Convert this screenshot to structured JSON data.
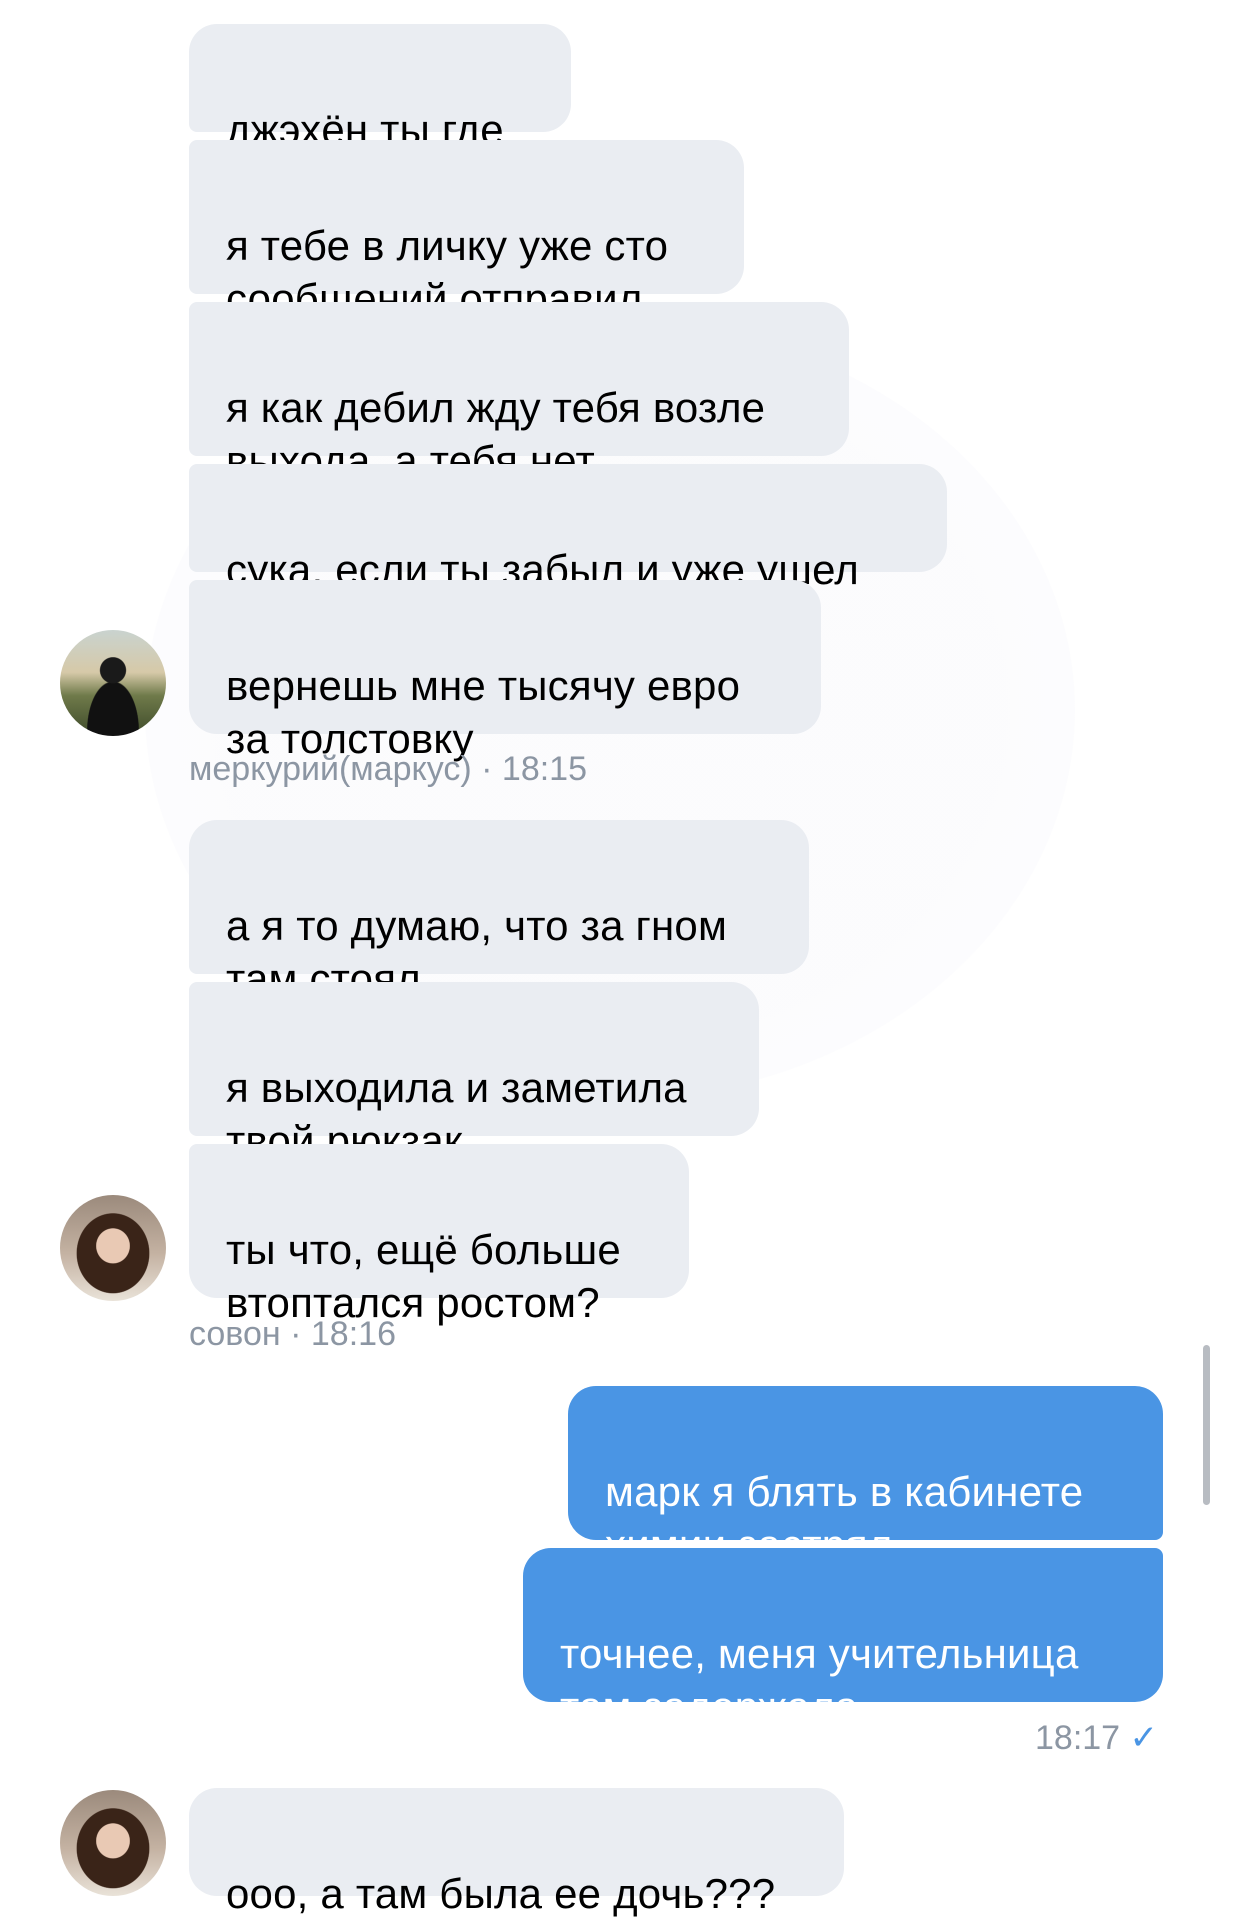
{
  "messages_group_1": {
    "sender": "меркурий(маркус)",
    "time": "· 18:15",
    "bubbles": [
      "джэхён ты где",
      "я тебе в личку уже сто\nсообщений отправил",
      "я как дебил жду тебя возле\nвыхода, а тебя нет",
      "сука, если ты забыл и уже ушел",
      "вернешь мне тысячу евро\nза толстовку"
    ]
  },
  "messages_group_2": {
    "sender": "совон",
    "time": "· 18:16",
    "bubbles": [
      "а я то думаю, что за гном\nтам стоял",
      "я выходила и заметила\nтвой рюкзак",
      "ты что, ещё больше\nвтоптался ростом?"
    ]
  },
  "outgoing_group": {
    "time": "18:17",
    "status_icon": "read-check-icon",
    "bubbles": [
      "марк я блять в кабинете\nхимии застрял",
      "точнее, меня учительница\nтам задержала"
    ]
  },
  "messages_group_3": {
    "bubbles": [
      "ооо, а там была ее дочь???"
    ]
  },
  "colors": {
    "incoming_bubble": "#eaedf2",
    "outgoing_bubble": "#4a95e4",
    "meta_text": "#8c96a3"
  }
}
